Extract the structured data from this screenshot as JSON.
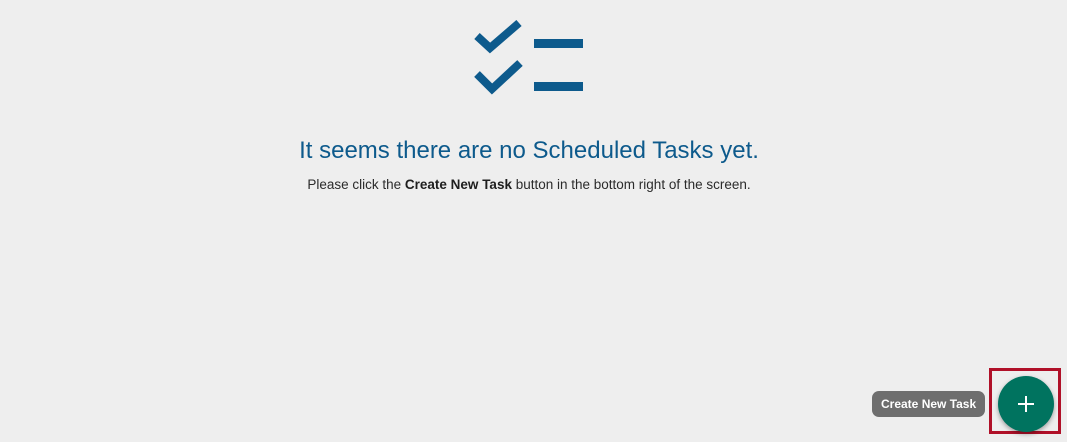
{
  "empty_state": {
    "icon": "checklist-icon",
    "title": "It seems there are no Scheduled Tasks yet.",
    "subtitle_before": "Please click the ",
    "subtitle_bold": "Create New Task",
    "subtitle_after": " button in the bottom right of the screen."
  },
  "fab": {
    "icon": "plus-icon",
    "tooltip": "Create New Task"
  },
  "colors": {
    "background": "#eeeeee",
    "accent_blue": "#0d5a8c",
    "fab_green": "#00735f",
    "highlight_red": "#b01028",
    "tooltip_gray": "#6e6e6e"
  }
}
